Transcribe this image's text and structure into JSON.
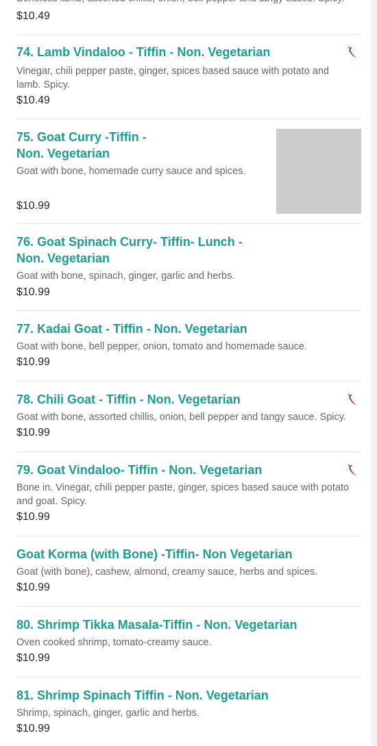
{
  "menu": {
    "top_partial": {
      "desc": "Boneless lamb, assorted chillis, onion, bell pepper and tangy sauce. Spicy.",
      "price": "$10.49"
    },
    "items": [
      {
        "title": "74. Lamb Vindaloo - Tiffin - Non. Vegetarian",
        "desc": "Vinegar, chili pepper paste, ginger, spices based sauce with potato and lamb. Spicy.",
        "price": "$10.49",
        "spicy": true
      },
      {
        "title": "75. Goat Curry -Tiffin - Non. Vegetarian",
        "desc": "Goat with bone, homemade curry sauce and spices.",
        "price": "$10.99",
        "has_image": true
      },
      {
        "title": "76. Goat Spinach Curry- Tiffin- Lunch - Non. Vegetarian",
        "desc": "Goat with bone, spinach, ginger, garlic and herbs.",
        "price": "$10.99"
      },
      {
        "title": "77. Kadai Goat - Tiffin - Non. Vegetarian",
        "desc": "Goat with bone, bell pepper, onion, tomato and homemade sauce.",
        "price": "$10.99"
      },
      {
        "title": "78. Chili Goat - Tiffin - Non. Vegetarian",
        "desc": "Goat with bone, assorted chillis, onion, bell pepper and tangy sauce. Spicy.",
        "price": "$10.99",
        "spicy": true
      },
      {
        "title": "79. Goat Vindaloo- Tiffin - Non. Vegetarian",
        "desc": "Bone in. Vinegar, chili pepper paste, ginger, spices based sauce with potato and goat. Spicy.",
        "price": "$10.99",
        "spicy": true
      },
      {
        "title": "Goat Korma (with Bone) -Tiffin- Non Vegetarian",
        "desc": "Goat (with bone), cashew, almond, creamy sauce, herbs and spices.",
        "price": "$10.99"
      },
      {
        "title": "80. Shrimp Tikka Masala-Tiffin - Non. Vegetarian",
        "desc": "Oven cooked shrimp, tomato-creamy sauce.",
        "price": "$10.99"
      },
      {
        "title": "81. Shrimp Spinach Tiffin - Non. Vegetarian",
        "desc": "Shrimp, spinach, ginger, garlic and herbs.",
        "price": "$10.99"
      }
    ]
  },
  "colors": {
    "title": "#1a9e93",
    "desc": "#666666",
    "price": "#222222",
    "chili": "#d42a22"
  },
  "icons": {
    "spicy": "chili-pepper-icon",
    "placeholder": "food-image-placeholder"
  }
}
